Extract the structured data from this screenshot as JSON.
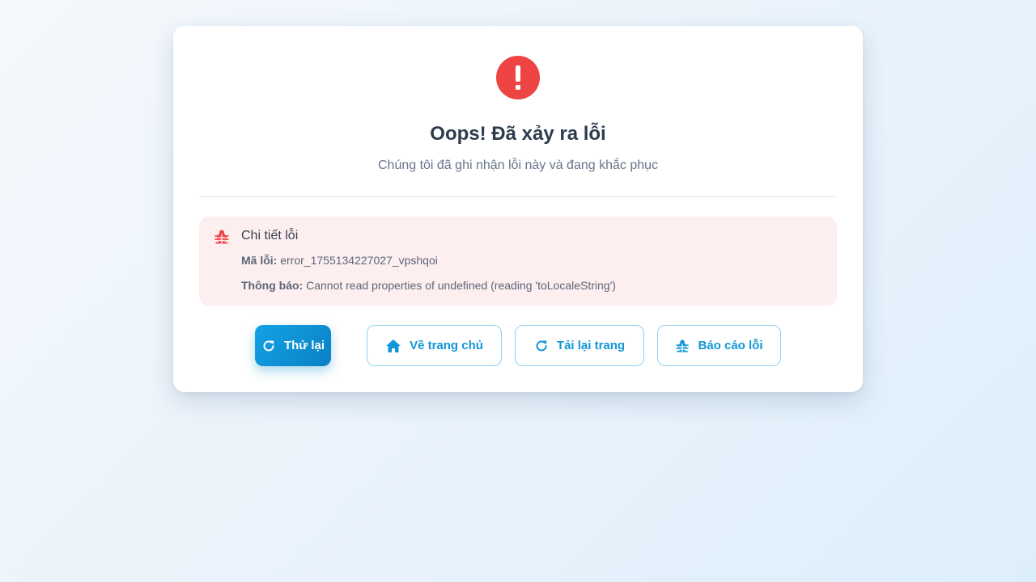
{
  "error": {
    "title": "Oops! Đã xảy ra lỗi",
    "subtitle": "Chúng tôi đã ghi nhận lỗi này và đang khắc phục"
  },
  "details": {
    "heading": "Chi tiết lỗi",
    "code_label": "Mã lỗi:",
    "code_value": "error_1755134227027_vpshqoi",
    "message_label": "Thông báo:",
    "message_value": "Cannot read properties of undefined (reading 'toLocaleString')"
  },
  "actions": {
    "retry": "Thử lại",
    "home": "Về trang chủ",
    "reload": "Tải lại trang",
    "report": "Báo cáo lỗi"
  },
  "icons": {
    "error": "exclamation-icon",
    "bug": "bug-icon",
    "retry": "refresh-icon",
    "home": "home-icon"
  },
  "colors": {
    "error_red": "#ef4444",
    "accent_blue": "#1296d6",
    "detail_bg": "#fdeeef"
  }
}
